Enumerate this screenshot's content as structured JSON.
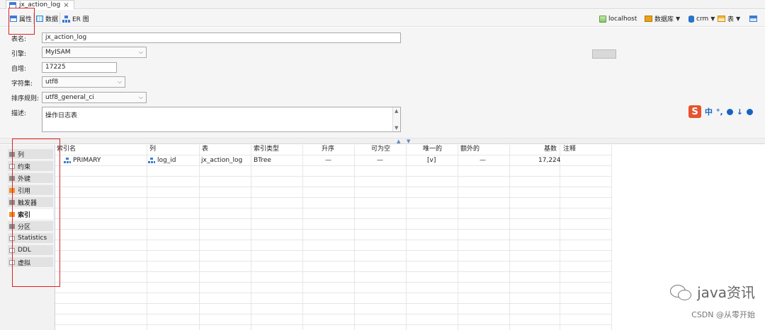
{
  "tab": {
    "title": "jx_action_log",
    "close": "×"
  },
  "toolbar": {
    "properties": "属性",
    "data": "数据",
    "er": "ER 图",
    "host": "localhost",
    "database": "数据库",
    "schema": "crm",
    "table": "表"
  },
  "form": {
    "name_label": "表名:",
    "name_value": "jx_action_log",
    "engine_label": "引擎:",
    "engine_value": "MyISAM",
    "autoinc_label": "自增:",
    "autoinc_value": "17225",
    "charset_label": "字符集:",
    "charset_value": "utf8",
    "collation_label": "排序规则:",
    "collation_value": "utf8_general_ci",
    "desc_label": "描述:",
    "desc_value": "操作日志表"
  },
  "ime": {
    "zh": "中"
  },
  "subtabs": [
    {
      "label": "列",
      "icon": "grey"
    },
    {
      "label": "约束",
      "icon": "outline"
    },
    {
      "label": "外键",
      "icon": "grey"
    },
    {
      "label": "引用",
      "icon": "orange"
    },
    {
      "label": "触发器",
      "icon": "grey"
    },
    {
      "label": "索引",
      "icon": "orange",
      "active": true
    },
    {
      "label": "分区",
      "icon": "grey"
    },
    {
      "label": "Statistics",
      "icon": "outline"
    },
    {
      "label": "DDL",
      "icon": "outline"
    },
    {
      "label": "虚拟",
      "icon": "outline"
    }
  ],
  "grid": {
    "headers": [
      "索引名",
      "列",
      "表",
      "索引类型",
      "升序",
      "可为空",
      "唯一的",
      "额外的",
      "基数",
      "注释"
    ],
    "rows": [
      [
        "PRIMARY",
        "log_id",
        "jx_action_log",
        "BTree",
        "—",
        "—",
        "[v]",
        "—",
        "17,224",
        ""
      ]
    ]
  },
  "watermark": {
    "brand": "java资讯",
    "sub": "CSDN @从零开始"
  },
  "colors": {
    "highlight": "#e02020",
    "accent": "#3a7bd5",
    "orange": "#f28c28"
  }
}
